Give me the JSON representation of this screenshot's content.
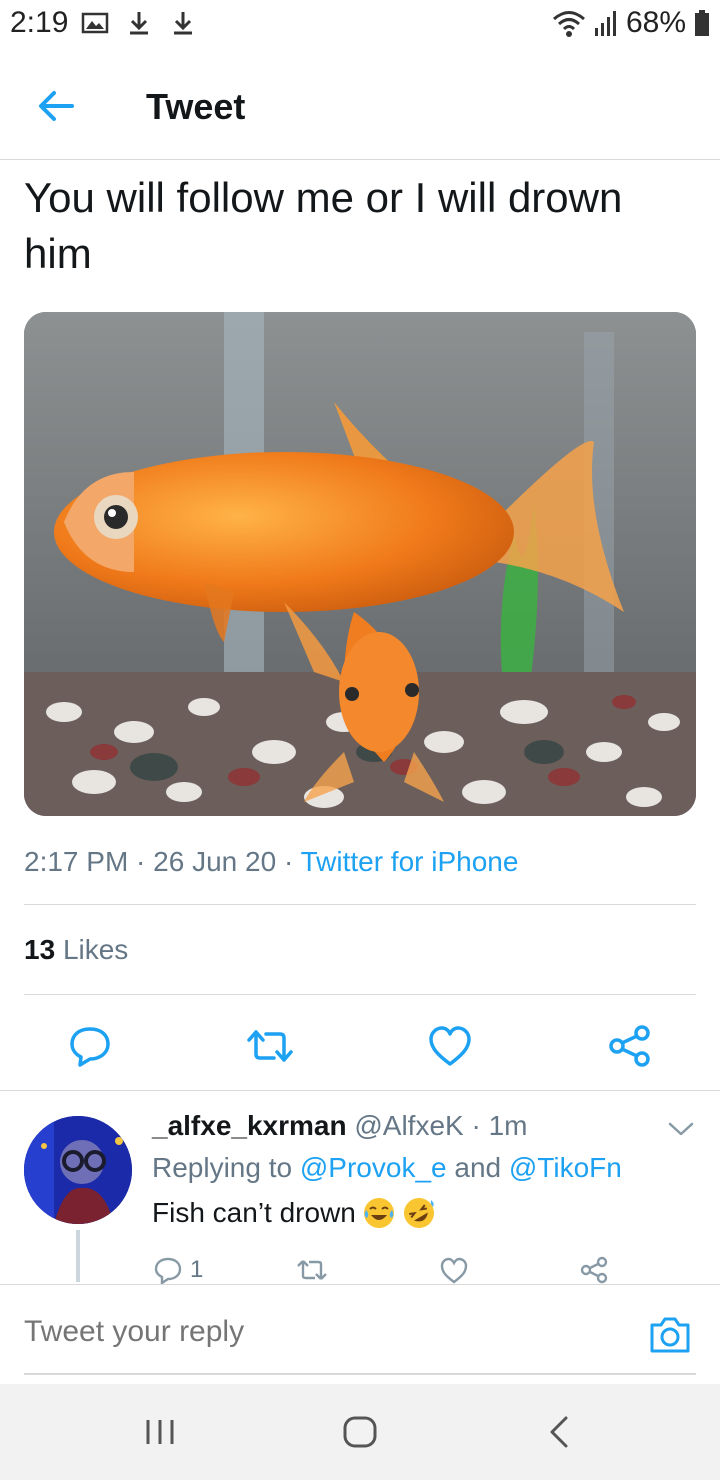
{
  "status_bar": {
    "time": "2:19",
    "battery": "68%"
  },
  "header": {
    "title": "Tweet"
  },
  "tweet": {
    "text": "You will follow me or I will drown him",
    "time": "2:17 PM",
    "dot1": " · ",
    "date": "26 Jun 20",
    "dot2": " · ",
    "source": "Twitter for iPhone",
    "likes_count": "13",
    "likes_label": "Likes"
  },
  "reply": {
    "display_name": "_alfxe_kxrman",
    "handle": "@AlfxeK",
    "dot": " · ",
    "time": "1m",
    "replying_prefix": "Replying to ",
    "mention1": "@Provok_e",
    "and": " and ",
    "mention2": "@TikoFn",
    "body": "Fish can’t drown",
    "reply_count": "1"
  },
  "compose": {
    "placeholder": "Tweet your reply"
  },
  "colors": {
    "accent": "#1da1f2",
    "muted": "#657786",
    "text": "#14171a",
    "divider": "#d9d9d9"
  },
  "icons": [
    "back-arrow-icon",
    "reply-icon",
    "retweet-icon",
    "like-icon",
    "share-icon",
    "camera-icon",
    "chevron-down-icon"
  ]
}
